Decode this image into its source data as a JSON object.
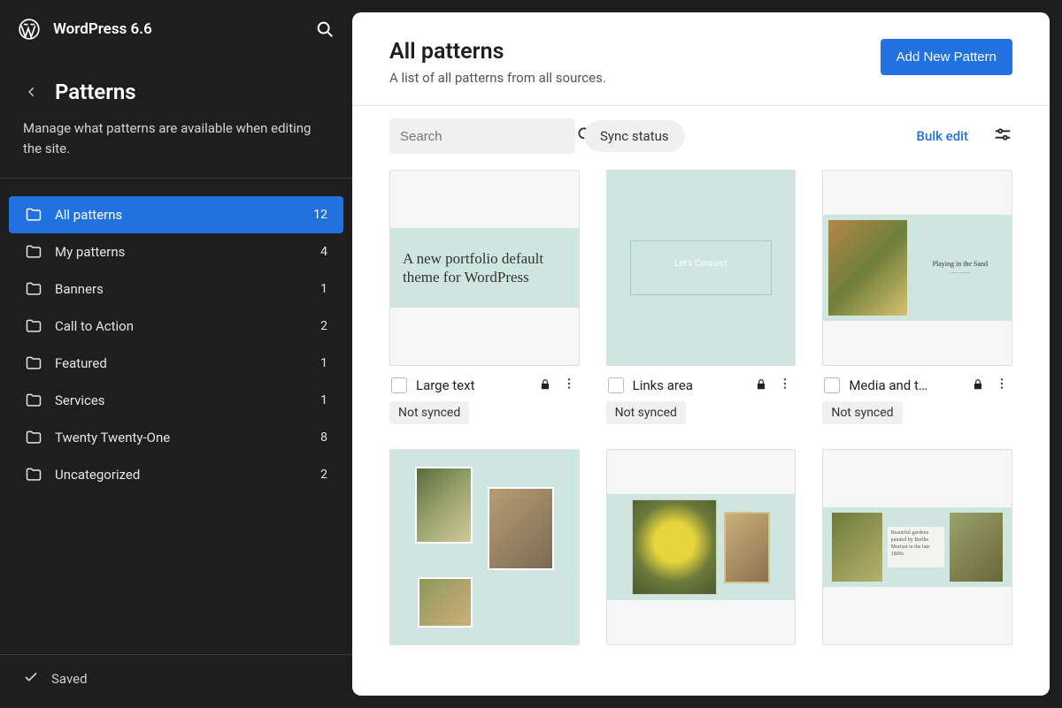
{
  "header": {
    "site_title": "WordPress 6.6"
  },
  "section": {
    "title": "Patterns",
    "description": "Manage what patterns are available when editing the site."
  },
  "nav": [
    {
      "label": "All patterns",
      "count": "12",
      "active": true
    },
    {
      "label": "My patterns",
      "count": "4",
      "active": false
    },
    {
      "label": "Banners",
      "count": "1",
      "active": false
    },
    {
      "label": "Call to Action",
      "count": "2",
      "active": false
    },
    {
      "label": "Featured",
      "count": "1",
      "active": false
    },
    {
      "label": "Services",
      "count": "1",
      "active": false
    },
    {
      "label": "Twenty Twenty-One",
      "count": "8",
      "active": false
    },
    {
      "label": "Uncategorized",
      "count": "2",
      "active": false
    }
  ],
  "footer": {
    "saved": "Saved"
  },
  "main": {
    "title": "All patterns",
    "subtitle": "A list of all patterns from all sources.",
    "add_button": "Add New Pattern",
    "search_placeholder": "Search",
    "sync_status": "Sync status",
    "bulk_edit": "Bulk edit"
  },
  "cards": [
    {
      "title": "Large text",
      "badge": "Not synced",
      "preview_text": "A new portfolio default theme for WordPress"
    },
    {
      "title": "Links area",
      "badge": "Not synced",
      "preview_text": "Let's Connect"
    },
    {
      "title": "Media and t…",
      "badge": "Not synced",
      "preview_text": "Playing in the Sand"
    },
    {
      "title": "",
      "badge": "",
      "preview_text": ""
    },
    {
      "title": "",
      "badge": "",
      "preview_text": ""
    },
    {
      "title": "",
      "badge": "",
      "preview_text": "Beautiful gardens painted by Berthe Morisot in the late 1800s"
    }
  ]
}
